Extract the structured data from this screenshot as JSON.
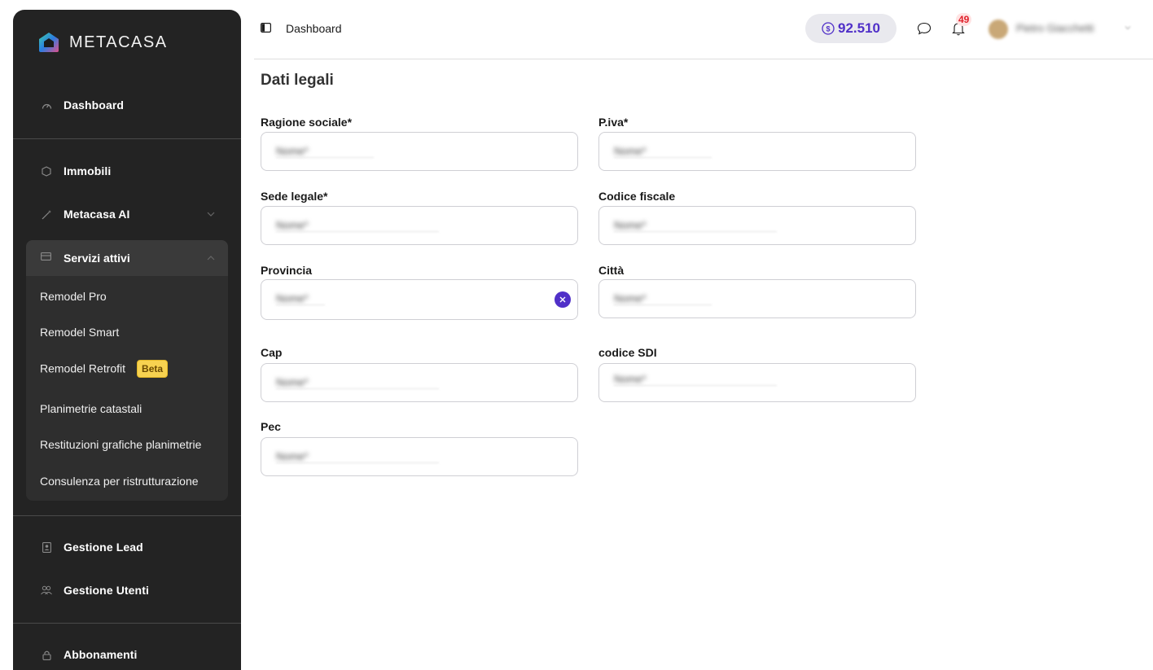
{
  "brand": {
    "name": "METACASA"
  },
  "sidebar": {
    "items": [
      {
        "label": "Dashboard",
        "icon": "gauge-icon"
      },
      {
        "label": "Immobili",
        "icon": "cube-icon"
      },
      {
        "label": "Metacasa AI",
        "icon": "magic-wand-icon"
      },
      {
        "label": "Servizi attivi",
        "icon": "card-icon"
      },
      {
        "label": "Gestione Lead",
        "icon": "contact-card-icon"
      },
      {
        "label": "Gestione Utenti",
        "icon": "users-icon"
      },
      {
        "label": "Abbonamenti",
        "icon": "lock-icon"
      }
    ],
    "services": [
      {
        "label": "Remodel Pro"
      },
      {
        "label": "Remodel Smart"
      },
      {
        "label": "Remodel Retrofit",
        "badge": "Beta"
      },
      {
        "label": "Planimetrie catastali"
      },
      {
        "label": "Restituzioni grafiche planimetrie"
      },
      {
        "label": "Consulenza per ristrutturazione"
      }
    ]
  },
  "header": {
    "breadcrumb": "Dashboard",
    "credits": "92.510",
    "notification_count": "49",
    "user_name": "Pietro Giacchetti"
  },
  "form": {
    "title": "Dati legali",
    "fields": [
      {
        "label": "Ragione sociale*",
        "value": "Nome*"
      },
      {
        "label": "P.iva*",
        "value": "Nome*"
      },
      {
        "label": "Sede legale*",
        "value": "Nome*"
      },
      {
        "label": "Codice fiscale",
        "value": "Nome*"
      },
      {
        "label": "Provincia",
        "value": "Nome*"
      },
      {
        "label": "Città",
        "value": "Nome*"
      },
      {
        "label": "Cap",
        "value": "Nome*"
      },
      {
        "label": "codice SDI",
        "value": "Nome*"
      },
      {
        "label": "Pec",
        "value": "Nome*"
      }
    ]
  },
  "colors": {
    "sidebar_bg": "#232323",
    "accent": "#5030c8",
    "beta_badge": "#f7d250",
    "notification": "#e0202a"
  }
}
